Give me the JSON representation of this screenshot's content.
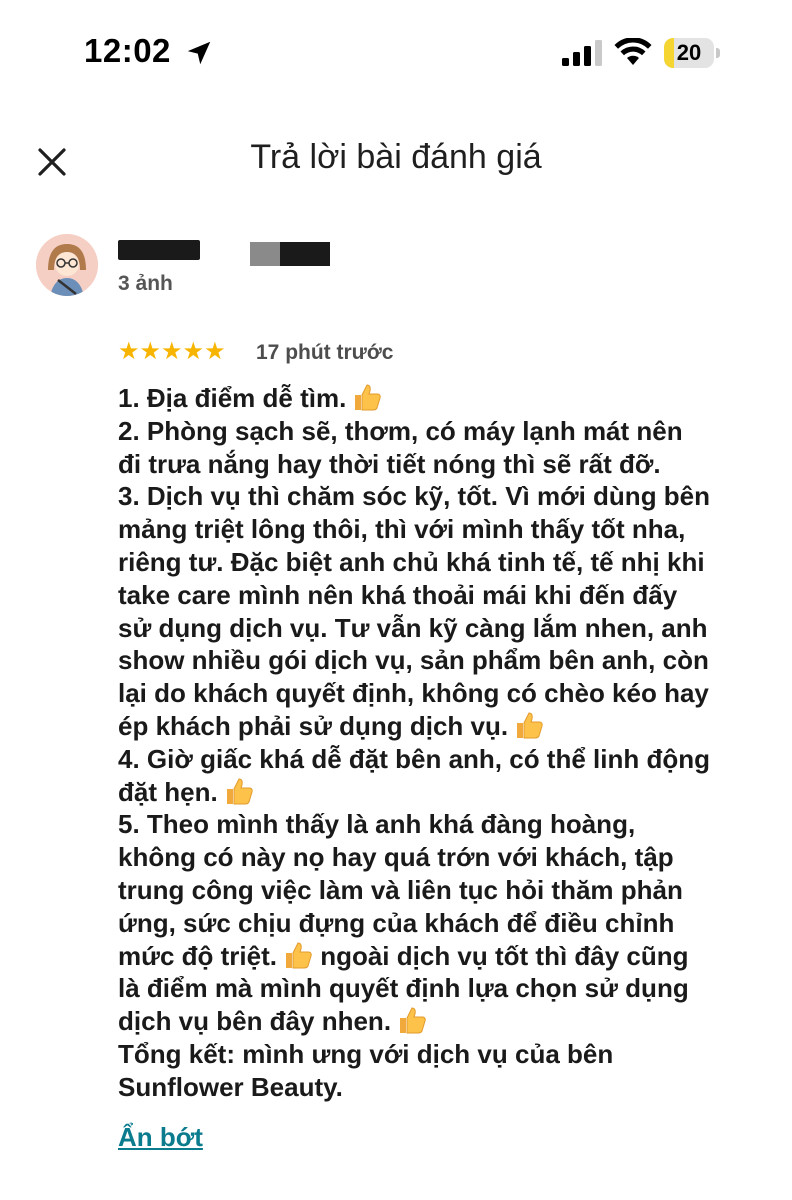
{
  "status_bar": {
    "time": "12:02",
    "battery_percent": "20",
    "battery_level": 0.2,
    "icons": [
      "location-arrow-icon",
      "cellular-signal-icon",
      "wifi-icon",
      "battery-icon"
    ]
  },
  "header": {
    "title": "Trả lời bài đánh giá",
    "close_icon": "close-icon"
  },
  "reviewer": {
    "photo_count_label": "3 ảnh"
  },
  "review": {
    "rating": 5,
    "stars_text": "★★★★★",
    "time_ago": "17 phút trước",
    "lines": [
      "1. Địa điểm dễ tìm.",
      "2. Phòng sạch sẽ, thơm, có máy lạnh mát nên",
      "đi trưa nắng hay thời tiết nóng thì sẽ rất đỡ.",
      "3. Dịch vụ thì chăm sóc kỹ, tốt. Vì mới dùng bên",
      "mảng triệt lông thôi, thì với mình thấy tốt nha,",
      "riêng tư. Đặc biệt anh chủ khá tinh tế, tế nhị khi",
      "take care mình nên khá thoải mái khi đến đấy",
      "sử dụng dịch vụ. Tư vẫn kỹ càng lắm nhen, anh",
      "show nhiều gói dịch vụ, sản phẩm bên anh, còn",
      "lại do khách quyết định, không có chèo kéo hay",
      "ép khách phải sử dụng dịch vụ.",
      "4. Giờ giấc khá dễ đặt bên anh, có thể linh động",
      "đặt hẹn.",
      "5. Theo mình thấy là anh khá đàng hoàng,",
      "không có này nọ hay quá trớn với khách, tập",
      "trung công việc làm và liên tục hỏi thăm phản",
      "ứng, sức chịu đựng của khách để điều chỉnh",
      "mức độ triệt.",
      "là điểm mà mình quyết định lựa chọn sử dụng",
      "dịch vụ bên đây nhen.",
      "Tổng kết: mình ưng với dịch vụ của bên",
      "Sunflower Beauty."
    ],
    "line18_continuation": "ngoài dịch vụ tốt thì đây cũng",
    "thumb_icon": "thumbs-up-icon"
  },
  "actions": {
    "collapse_label": "Ẩn bớt"
  },
  "colors": {
    "star": "#f7b400",
    "link": "#0b7b8e",
    "battery": "#f4d531"
  }
}
